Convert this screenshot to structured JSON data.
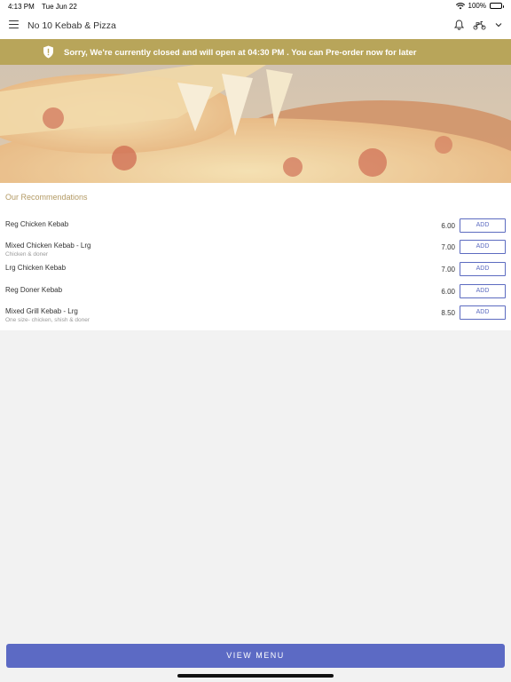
{
  "status": {
    "time": "4:13 PM",
    "date": "Tue Jun 22",
    "battery": "100%"
  },
  "header": {
    "title": "No 10 Kebab & Pizza",
    "icons": [
      "menu-icon",
      "bell-icon",
      "scooter-icon",
      "chevron-down-icon"
    ]
  },
  "banner": {
    "text": "Sorry, We're currently closed and will open at 04:30 PM . You can Pre-order now for later",
    "color": "#b8a55a"
  },
  "recommendations": {
    "title": "Our Recommendations",
    "items": [
      {
        "name": "Reg Chicken Kebab",
        "desc": "",
        "price": "6.00",
        "button": "ADD"
      },
      {
        "name": "Mixed Chicken Kebab - Lrg",
        "desc": "Chicken & doner",
        "price": "7.00",
        "button": "ADD"
      },
      {
        "name": "Lrg Chicken Kebab",
        "desc": "",
        "price": "7.00",
        "button": "ADD"
      },
      {
        "name": "Reg Doner Kebab",
        "desc": "",
        "price": "6.00",
        "button": "ADD"
      },
      {
        "name": "Mixed Grill Kebab - Lrg",
        "desc": "One size- chicken, shish & doner",
        "price": "8.50",
        "button": "ADD"
      }
    ]
  },
  "footer": {
    "button": "VIEW MENU",
    "accent": "#5c6ac4"
  }
}
